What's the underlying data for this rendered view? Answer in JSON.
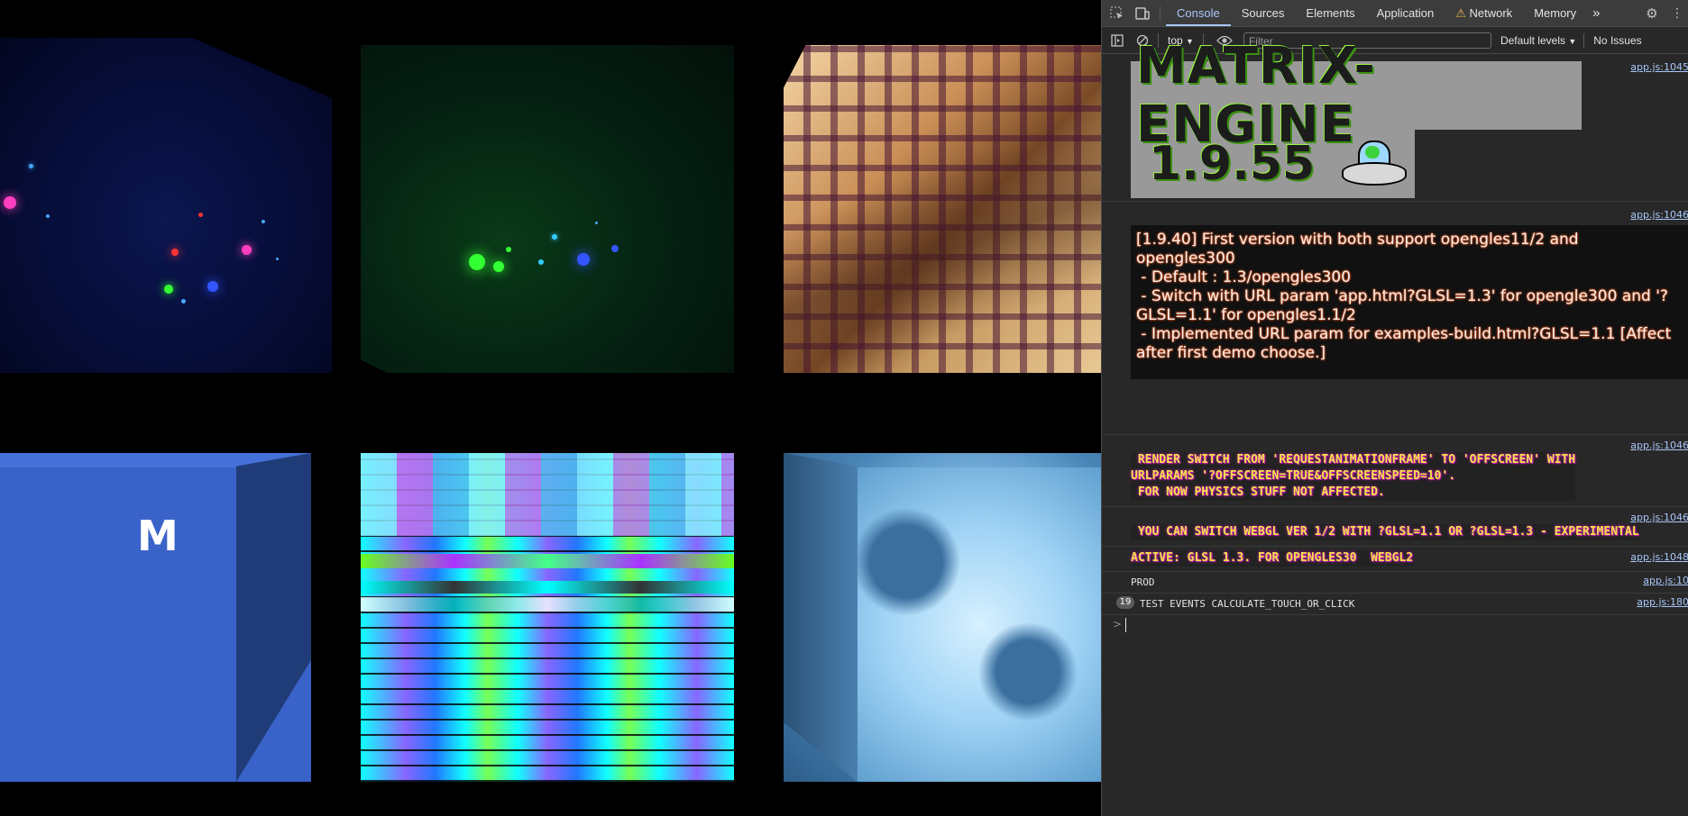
{
  "devtools": {
    "tabs": [
      "Console",
      "Sources",
      "Elements",
      "Application",
      "Network",
      "Memory"
    ],
    "active_tab": "Console",
    "toolbar": {
      "context": "top",
      "filter_placeholder": "Filter",
      "levels": "Default levels",
      "issues": "No Issues"
    }
  },
  "console": {
    "banner_title": "MATRIX-ENGINE",
    "banner_version": "1.9.55",
    "message1_lines": [
      "[1.9.40] First version with both support opengles11/2 and",
      "opengles300",
      " - Default : 1.3/opengles300",
      " - Switch with URL param 'app.html?GLSL=1.3' for opengle300 and '?",
      "GLSL=1.1' for opengles1.1/2",
      " - Implemented URL param for examples-build.html?GLSL=1.1 [Affect",
      "after first demo choose.]"
    ],
    "message2_lines": [
      " RENDER SWITCH FROM 'REQUESTANIMATIONFRAME' TO 'OFFSCREEN' WITH",
      "URLPARAMS '?OFFSCREEN=TRUE&OFFSCREENSPEED=10'.",
      " FOR NOW PHYSICS STUFF NOT AFFECTED."
    ],
    "message3": " YOU CAN SWITCH WEBGL VER 1/2 WITH ?GLSL=1.1 OR ?GLSL=1.3 - EXPERIMENTAL",
    "message4": "ACTIVE: GLSL 1.3. FOR OPENGLES30  WEBGL2",
    "message5": "PROD",
    "message6": "TEST EVENTS CALCULATE_TOUCH_OR_CLICK",
    "message6_count": "19",
    "sources": [
      "app.js:1045",
      "app.js:1046",
      "app.js:1046",
      "app.js:1046",
      "app.js:1048",
      "app.js:10",
      "app.js:180"
    ],
    "prompt": ">"
  },
  "scene": {
    "cube_logo": "M"
  }
}
